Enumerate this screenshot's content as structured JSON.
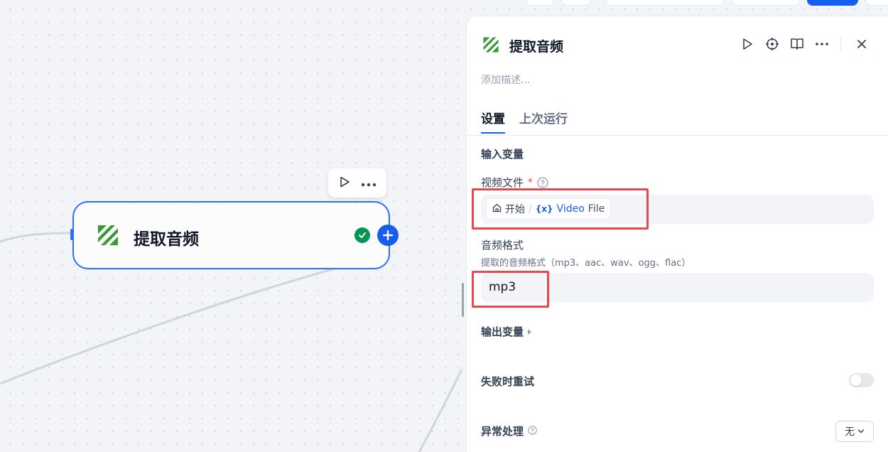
{
  "node": {
    "title": "提取音频",
    "status": "success"
  },
  "panel": {
    "title": "提取音频",
    "description_placeholder": "添加描述...",
    "tabs": [
      {
        "label": "设置",
        "active": true
      },
      {
        "label": "上次运行",
        "active": false
      }
    ],
    "input_section": "输入变量",
    "video_file": {
      "label": "视频文件",
      "required_mark": "*",
      "source_node": "开始",
      "separator": "/",
      "variable_icon": "{x}",
      "variable_name": "Video",
      "variable_type": "File"
    },
    "audio_format": {
      "label": "音频格式",
      "hint": "提取的音频格式（mp3、aac、wav、ogg、flac）",
      "value": "mp3"
    },
    "output_section": "输出变量",
    "retry_label": "失败时重试",
    "retry_enabled": false,
    "error_label": "异常处理",
    "error_value": "无"
  },
  "colors": {
    "accent": "#155eef",
    "success": "#079455",
    "highlight": "#e5484d"
  }
}
